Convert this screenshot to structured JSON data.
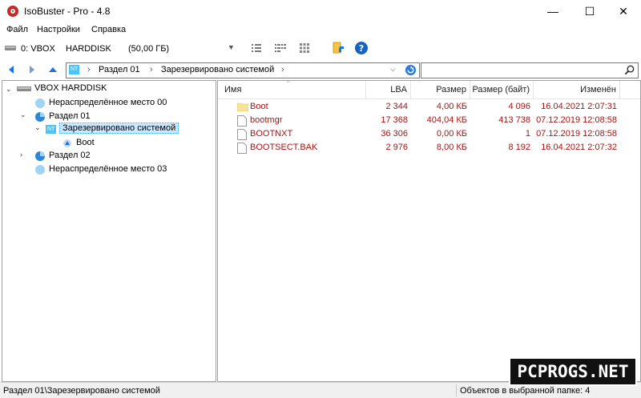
{
  "window": {
    "title": "IsoBuster - Pro - 4.8"
  },
  "menu": [
    "Файл",
    "Настройки",
    "Справка"
  ],
  "toolbar": {
    "drive_id": "0: VBOX",
    "drive_name": "HARDDISK",
    "drive_size": "(50,00 ГБ)"
  },
  "address": {
    "segments": [
      "Раздел 01",
      "Зарезервировано системой"
    ],
    "badge": "NT"
  },
  "tree": {
    "root": "VBOX HARDDISK",
    "items": [
      {
        "label": "Нераспределённое место 00"
      },
      {
        "label": "Раздел 01"
      },
      {
        "label": "Зарезервировано системой"
      },
      {
        "label": "Boot"
      },
      {
        "label": "Раздел 02"
      },
      {
        "label": "Нераспределённое место 03"
      }
    ]
  },
  "list": {
    "columns": [
      "Имя",
      "LBA",
      "Размер",
      "Размер (байт)",
      "Изменён"
    ],
    "rows": [
      {
        "name": "Boot",
        "lba": "2 344",
        "size": "4,00 КБ",
        "bytes": "4 096",
        "modified": "16.04.2021 2:07:31",
        "kind": "folder"
      },
      {
        "name": "bootmgr",
        "lba": "17 368",
        "size": "404,04 КБ",
        "bytes": "413 738",
        "modified": "07.12.2019 12:08:58",
        "kind": "file"
      },
      {
        "name": "BOOTNXT",
        "lba": "36 306",
        "size": "0,00 КБ",
        "bytes": "1",
        "modified": "07.12.2019 12:08:58",
        "kind": "file"
      },
      {
        "name": "BOOTSECT.BAK",
        "lba": "2 976",
        "size": "8,00 КБ",
        "bytes": "8 192",
        "modified": "16.04.2021 2:07:32",
        "kind": "file"
      }
    ]
  },
  "status": {
    "path": "Раздел 01\\Зарезервировано системой",
    "count": "Объектов в выбранной папке: 4"
  },
  "watermark": "PCPROGS.NET",
  "colors": {
    "accent": "#1a73e8",
    "list_text": "#a31515",
    "selection": "#cce8ff"
  }
}
